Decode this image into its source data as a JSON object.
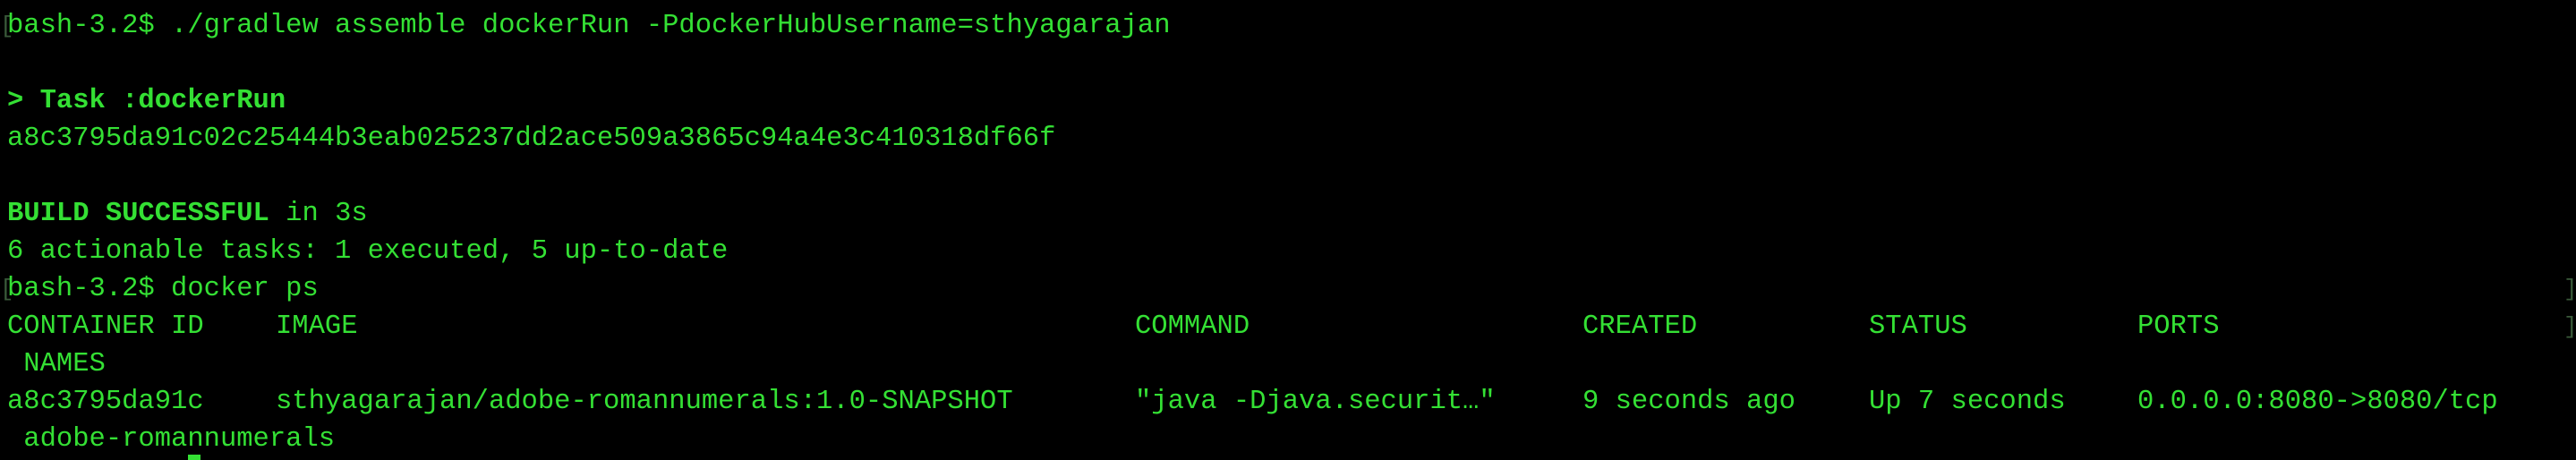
{
  "terminal": {
    "prompt": "bash-3.2$ ",
    "lines": {
      "cmd1": "bash-3.2$ ./gradlew assemble dockerRun -PdockerHubUsername=sthyagarajan",
      "task": "> Task :dockerRun",
      "container_hash": "a8c3795da91c02c25444b3eab025237dd2ace509a3865c94a4e3c410318df66f",
      "build_status": "BUILD SUCCESSFUL",
      "build_time": " in 3s",
      "tasks_summary": "6 actionable tasks: 1 executed, 5 up-to-date",
      "cmd2": "bash-3.2$ docker ps"
    },
    "ps_table": {
      "headers": {
        "container_id": "CONTAINER ID",
        "image": "IMAGE",
        "command": "COMMAND",
        "created": "CREATED",
        "status": "STATUS",
        "ports": "PORTS",
        "names": " NAMES"
      },
      "rows": [
        {
          "container_id": "a8c3795da91c",
          "image": "sthyagarajan/adobe-romannumerals:1.0-SNAPSHOT",
          "command": "\"java -Djava.securit…\"",
          "created": "9 seconds ago",
          "status": "Up 7 seconds",
          "ports": "0.0.0.0:8080->8080/tcp",
          "names": " adobe-romannumerals"
        }
      ]
    },
    "colors": {
      "background": "#000000",
      "text": "#34e034"
    }
  }
}
